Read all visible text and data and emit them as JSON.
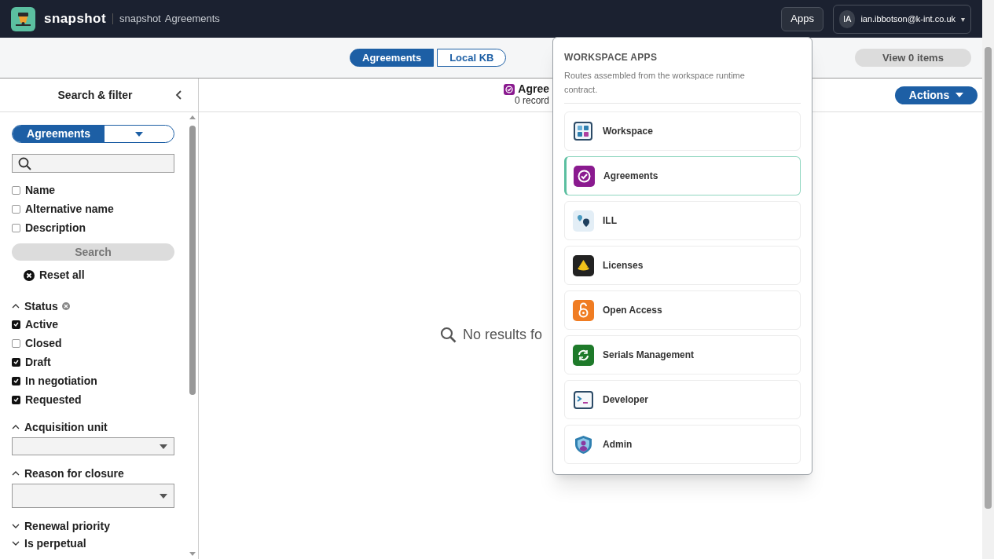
{
  "header": {
    "brand": "snapshot",
    "breadcrumb": [
      "snapshot",
      "Agreements"
    ],
    "apps_button": "Apps",
    "user": {
      "initials": "IA",
      "email": "ian.ibbotson@k-int.co.uk",
      "caret": "▾"
    }
  },
  "tabs": [
    {
      "label": "Agreements",
      "selected": true
    },
    {
      "label": "Local KB",
      "selected": false
    }
  ],
  "view_items_button": "View 0 items",
  "sidebar": {
    "title": "Search & filter",
    "scope": "Agreements",
    "search_fields": [
      {
        "label": "Name",
        "checked": false
      },
      {
        "label": "Alternative name",
        "checked": false
      },
      {
        "label": "Description",
        "checked": false
      }
    ],
    "search_button": "Search",
    "reset": "Reset all",
    "filters": [
      {
        "label": "Status",
        "expanded": true,
        "clearable": true,
        "kind": "checkboxes",
        "options": [
          {
            "label": "Active",
            "checked": true
          },
          {
            "label": "Closed",
            "checked": false
          },
          {
            "label": "Draft",
            "checked": true
          },
          {
            "label": "In negotiation",
            "checked": true
          },
          {
            "label": "Requested",
            "checked": true
          }
        ]
      },
      {
        "label": "Acquisition unit",
        "expanded": true,
        "kind": "select"
      },
      {
        "label": "Reason for closure",
        "expanded": true,
        "kind": "select"
      },
      {
        "label": "Renewal priority",
        "expanded": false,
        "kind": "collapsed"
      },
      {
        "label": "Is perpetual",
        "expanded": false,
        "kind": "collapsed"
      }
    ]
  },
  "main": {
    "title": "Agree",
    "count": "0 record",
    "actions_button": "Actions",
    "empty_message": "No results fo"
  },
  "apps_menu": {
    "heading": "WORKSPACE APPS",
    "description": "Routes assembled from the workspace runtime contract.",
    "items": [
      {
        "label": "Workspace",
        "selected": false
      },
      {
        "label": "Agreements",
        "selected": true
      },
      {
        "label": "ILL",
        "selected": false
      },
      {
        "label": "Licenses",
        "selected": false
      },
      {
        "label": "Open Access",
        "selected": false
      },
      {
        "label": "Serials Management",
        "selected": false
      },
      {
        "label": "Developer",
        "selected": false
      },
      {
        "label": "Admin",
        "selected": false
      }
    ]
  }
}
